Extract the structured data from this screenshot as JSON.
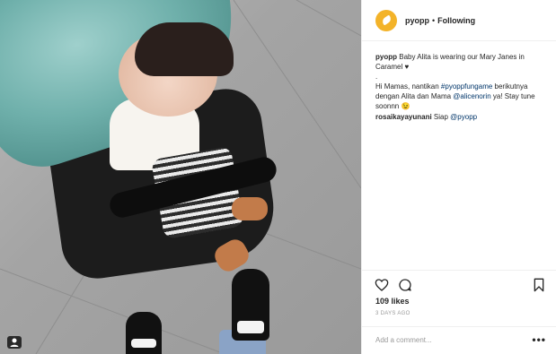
{
  "post": {
    "username": "pyopp",
    "follow_status": "Following",
    "caption_user": "pyopp",
    "caption_text": "Baby Alita is wearing our Mary Janes in Caramel ♥",
    "caption_dot": ".",
    "caption_p2_a": "Hi Mamas, nantikan ",
    "caption_hashtag": "#pyoppfungame",
    "caption_p2_b": " berikutnya dengan Alita dan Mama ",
    "caption_mention": "@alicenorin",
    "caption_p2_c": " ya! Stay tune soonnn 😉",
    "comment_user": "rosaikayayunani",
    "comment_text": " Siap ",
    "comment_mention": "@pyopp",
    "likes": "109 likes",
    "date": "3 DAYS AGO",
    "add_comment_placeholder": "Add a comment...",
    "more_label": "•••"
  },
  "icons": {
    "avatar": "pyopp-logo",
    "like": "heart-icon",
    "comment": "speech-bubble-icon",
    "save": "bookmark-icon",
    "photo_badge": "user-tag-icon"
  },
  "colors": {
    "accent_link": "#003569",
    "avatar_bg": "#f3b329",
    "muted": "#999999"
  }
}
